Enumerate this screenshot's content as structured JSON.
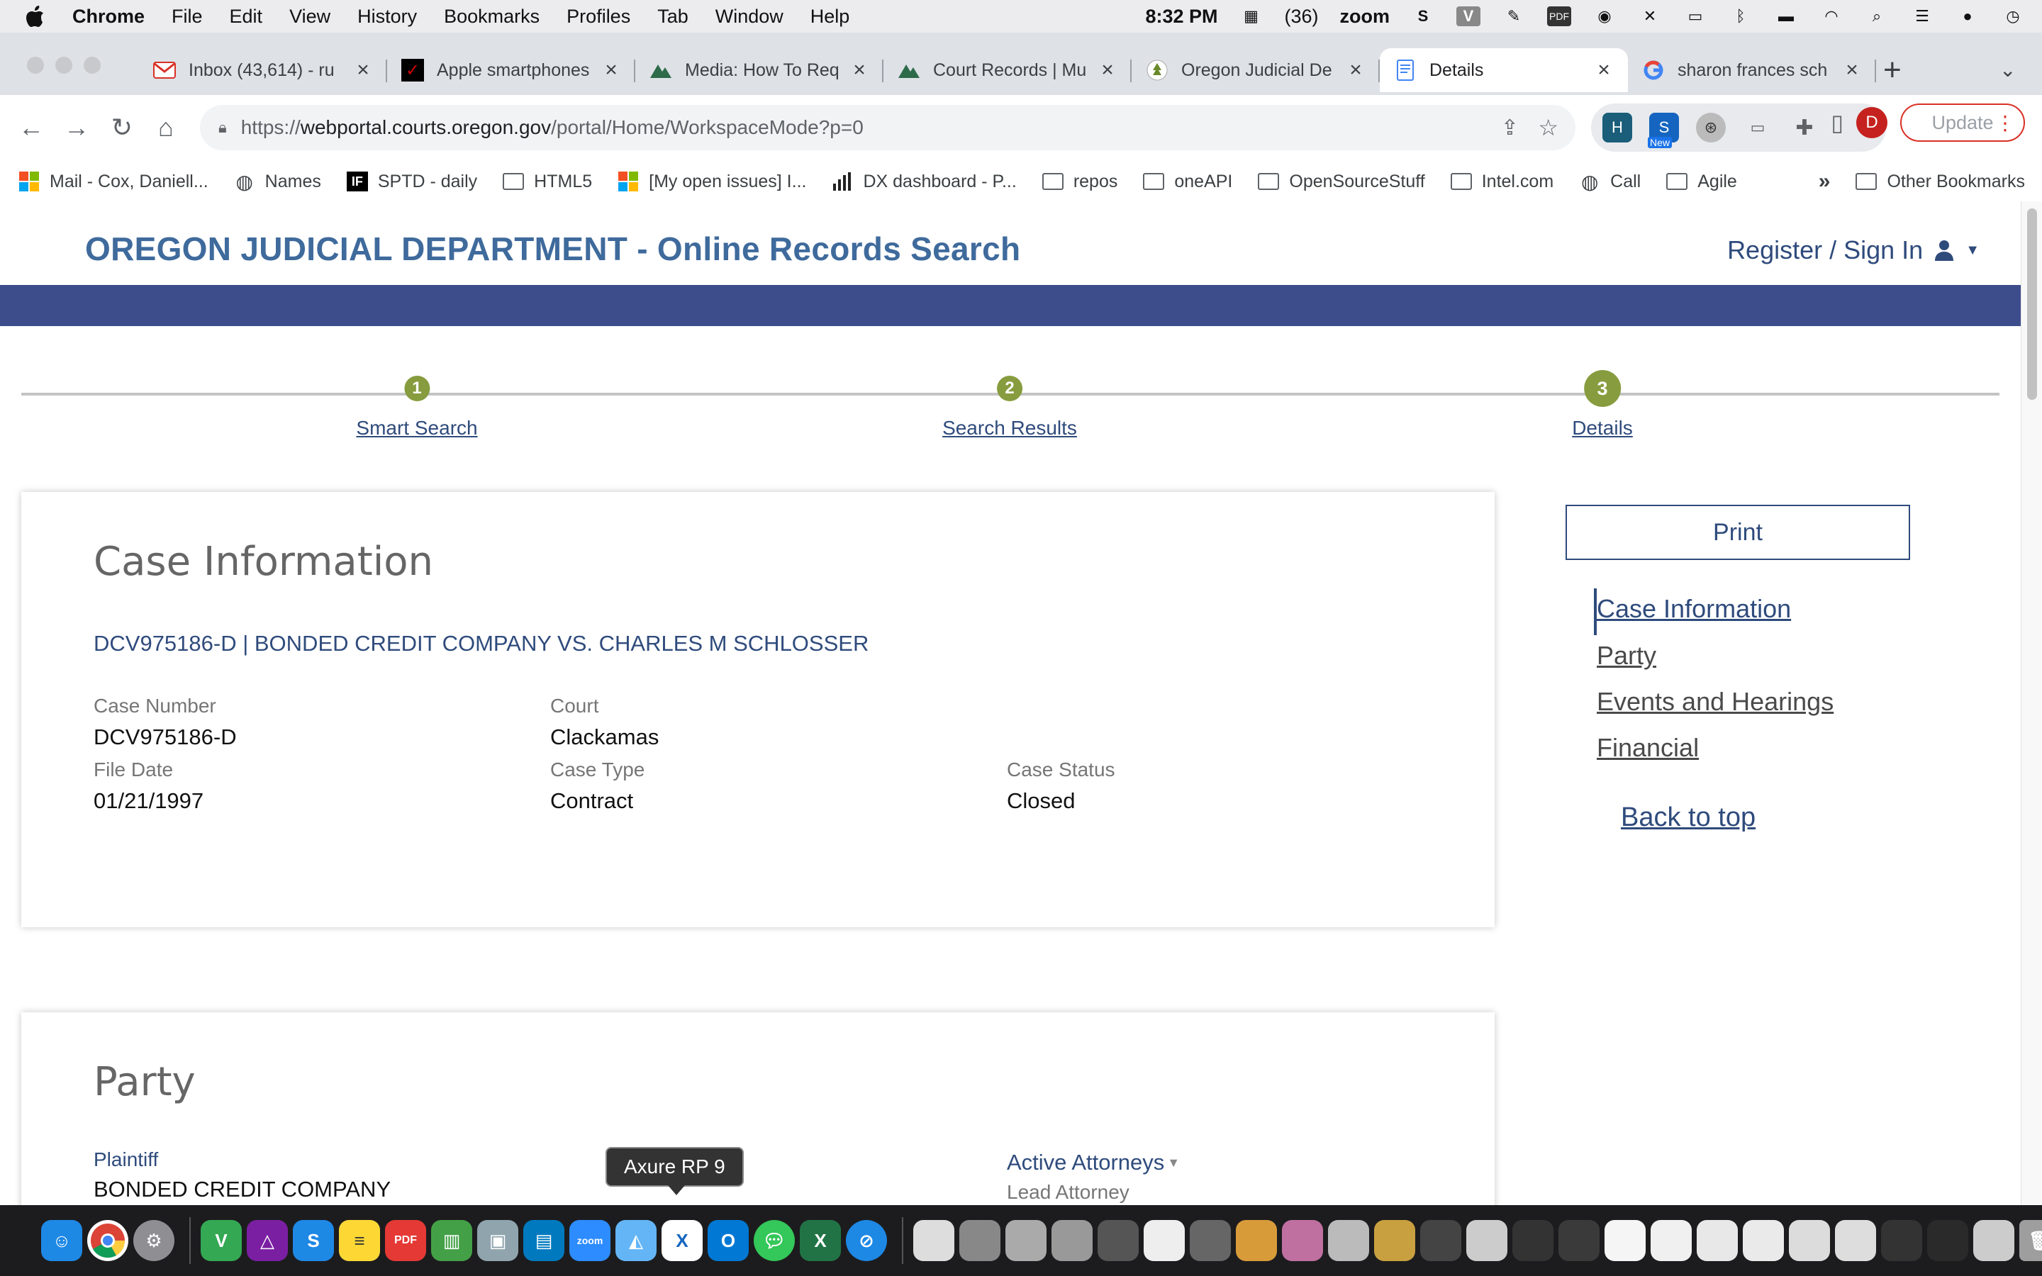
{
  "menubar": {
    "app": "Chrome",
    "items": [
      "File",
      "Edit",
      "View",
      "History",
      "Bookmarks",
      "Profiles",
      "Tab",
      "Window",
      "Help"
    ],
    "time": "8:32 PM",
    "calendar_count": "(36)",
    "zoom": "zoom"
  },
  "tabs": [
    {
      "title": "Inbox (43,614) - ru",
      "favicon": "gmail-icon",
      "color": "#d93025"
    },
    {
      "title": "Apple smartphones",
      "favicon": "verizon-icon",
      "color": "#cd040b"
    },
    {
      "title": "Media: How To Req",
      "favicon": "mountain-icon",
      "color": "#2e7d32"
    },
    {
      "title": "Court Records | Mu",
      "favicon": "mountain-icon",
      "color": "#2e7d32"
    },
    {
      "title": "Oregon Judicial De",
      "favicon": "tree-icon",
      "color": "#6a8a2a"
    },
    {
      "title": "Details",
      "favicon": "page-icon",
      "color": "#4285f4"
    },
    {
      "title": "sharon frances sch",
      "favicon": "google-icon",
      "color": "#4285f4"
    }
  ],
  "omnibox": {
    "scheme": "https://",
    "host": "webportal.courts.oregon.gov",
    "path": "/portal/Home/WorkspaceMode?p=0"
  },
  "toolbar": {
    "profile_initial": "D",
    "update_label": "Update",
    "ext_new_badge": "New"
  },
  "bookmarks": [
    {
      "label": "Mail - Cox, Daniell...",
      "icon": "microsoft-icon"
    },
    {
      "label": "Names",
      "icon": "globe-icon"
    },
    {
      "label": "SPTD - daily",
      "icon": "if-icon"
    },
    {
      "label": "HTML5",
      "icon": "folder-icon"
    },
    {
      "label": "[My open issues] I...",
      "icon": "microsoft-icon"
    },
    {
      "label": "DX dashboard - P...",
      "icon": "bars-icon"
    },
    {
      "label": "repos",
      "icon": "folder-icon"
    },
    {
      "label": "oneAPI",
      "icon": "folder-icon"
    },
    {
      "label": "OpenSourceStuff",
      "icon": "folder-icon"
    },
    {
      "label": "Intel.com",
      "icon": "folder-icon"
    },
    {
      "label": "Call",
      "icon": "globe-icon"
    },
    {
      "label": "Agile",
      "icon": "folder-icon"
    }
  ],
  "bookmarks_more": "»",
  "bookmarks_other": "Other Bookmarks",
  "site": {
    "title": "OREGON JUDICIAL DEPARTMENT - Online Records Search",
    "signin": "Register / Sign In"
  },
  "steps": [
    {
      "num": "1",
      "label": "Smart Search"
    },
    {
      "num": "2",
      "label": "Search Results"
    },
    {
      "num": "3",
      "label": "Details"
    }
  ],
  "case": {
    "heading": "Case Information",
    "title": "DCV975186-D | BONDED CREDIT COMPANY VS. CHARLES M SCHLOSSER",
    "case_number_label": "Case Number",
    "case_number": "DCV975186-D",
    "court_label": "Court",
    "court": "Clackamas",
    "file_date_label": "File Date",
    "file_date": "01/21/1997",
    "case_type_label": "Case Type",
    "case_type": "Contract",
    "case_status_label": "Case Status",
    "case_status": "Closed"
  },
  "party": {
    "heading": "Party",
    "plaintiff_label": "Plaintiff",
    "plaintiff": "BONDED CREDIT COMPANY",
    "attorneys_label": "Active Attorneys",
    "lead_attorney_label": "Lead Attorney"
  },
  "sidenav": {
    "print": "Print",
    "links": [
      "Case Information",
      "Party",
      "Events and Hearings",
      "Financial"
    ],
    "back_to_top": "Back to top"
  },
  "tooltip": "Axure RP 9",
  "colors": {
    "brand_blue": "#3f6a9c",
    "band_blue": "#3d4c8a",
    "link_blue": "#2f4b7c",
    "step_green": "#879c3e"
  }
}
